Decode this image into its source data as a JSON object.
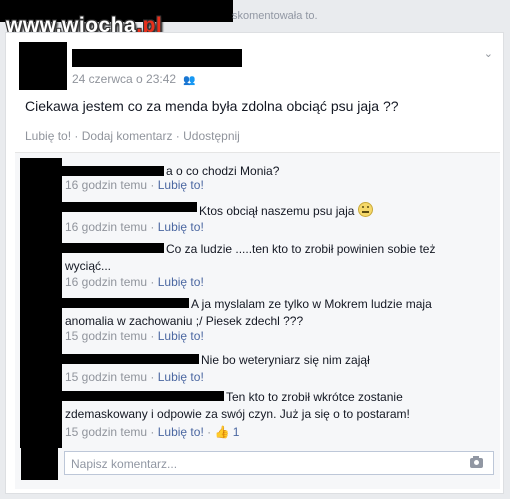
{
  "header": {
    "text": "skomentowała to."
  },
  "watermark": {
    "prefix": "www.wiocha",
    "suffix": ".pl"
  },
  "post": {
    "timestamp": "24 czerwca o 23:42",
    "text": "Ciekawa jestem co za menda była zdolna obciąć psu jaja ??",
    "actions": {
      "like": "Lubię to!",
      "sep": "·",
      "comment": "Dodaj komentarz",
      "share": "Udostępnij"
    }
  },
  "comments": [
    {
      "text": "a o co chodzi Monia?",
      "time": "16 godzin temu",
      "like": "Lubię to!"
    },
    {
      "text": "Ktos obciął naszemu psu jaja",
      "time": "16 godzin temu",
      "like": "Lubię to!"
    },
    {
      "line1": "Co za ludzie .....ten kto to zrobił powinien sobie też",
      "line2": "wyciąć...",
      "time": "16 godzin temu",
      "like": "Lubię to!"
    },
    {
      "line1": "A ja myslalam ze tylko w Mokrem ludzie maja",
      "line2": "anomalia w zachowaniu ;/ Piesek zdechl ???",
      "time": "15 godzin temu",
      "like": "Lubię to!"
    },
    {
      "text": "Nie bo weteryniarz się nim zajął",
      "time": "15 godzin temu",
      "like": "Lubię to!"
    },
    {
      "line1": "Ten kto to zrobił wkrótce zostanie",
      "line2": "zdemaskowany i odpowie za swój czyn. Już ja się o to postaram!",
      "time": "15 godzin temu",
      "like": "Lubię to!",
      "likes": "1"
    }
  ],
  "composer": {
    "placeholder": "Napisz komentarz..."
  }
}
